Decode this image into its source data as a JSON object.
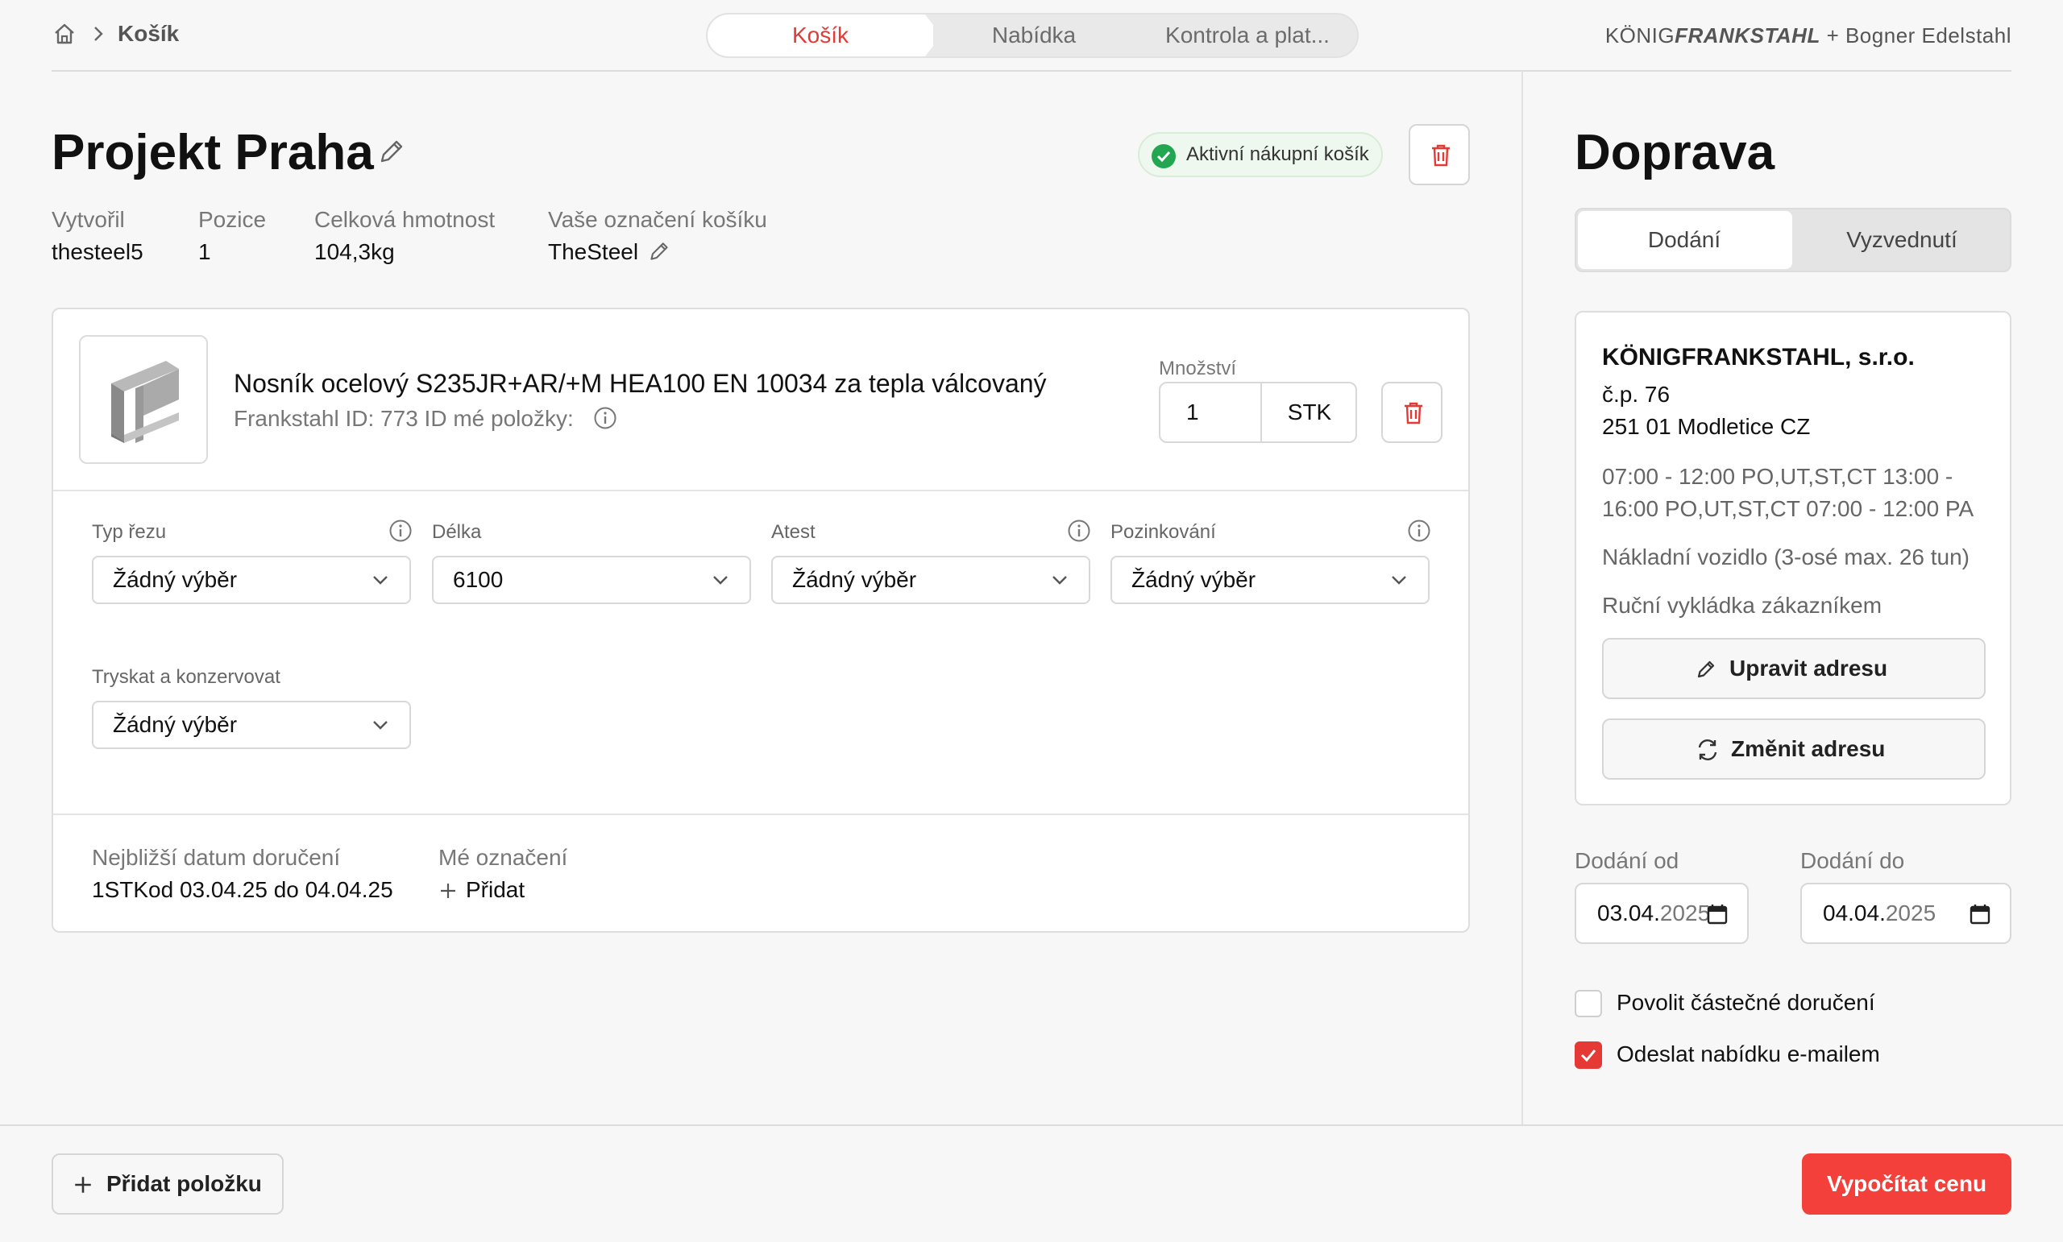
{
  "header": {
    "breadcrumb_label": "Košík",
    "steps": [
      "Košík",
      "Nabídka",
      "Kontrola a plat..."
    ],
    "brand_left": "KÖNIG",
    "brand_mid": "FRANKSTAHL",
    "brand_right": "+ Bogner Edelstahl"
  },
  "project": {
    "title": "Projekt Praha",
    "badge": "Aktivní nákupní košík",
    "meta": [
      {
        "label": "Vytvořil",
        "value": "thesteel5"
      },
      {
        "label": "Pozice",
        "value": "1"
      },
      {
        "label": "Celková hmotnost",
        "value": "104,3kg"
      },
      {
        "label": "Vaše označení košíku",
        "value": "TheSteel"
      }
    ]
  },
  "item": {
    "name": "Nosník ocelový S235JR+AR/+M HEA100 EN 10034 za tepla válcovaný",
    "sub": "Frankstahl ID: 773   ID mé položky:",
    "qty_label": "Množství",
    "qty_value": "1",
    "qty_unit": "STK",
    "fields": [
      {
        "label": "Typ řezu",
        "value": "Žádný výběr"
      },
      {
        "label": "Délka",
        "value": "6100"
      },
      {
        "label": "Atest",
        "value": "Žádný výběr"
      },
      {
        "label": "Pozinkování",
        "value": "Žádný výběr"
      },
      {
        "label": "Tryskat a konzervovat",
        "value": "Žádný výběr"
      }
    ],
    "delivery_label": "Nejbližší datum doručení",
    "delivery_value": "1STKod 03.04.25 do 04.04.25",
    "my_label_label": "Mé označení",
    "my_label_action": "Přidat"
  },
  "transport": {
    "title": "Doprava",
    "tabs": [
      "Dodání",
      "Vyzvednutí"
    ],
    "company": "KÖNIGFRANKSTAHL, s.r.o.",
    "street": "č.p. 76",
    "city": "251 01 Modletice CZ",
    "hours": "07:00 - 12:00 PO,UT,ST,CT 13:00 - 16:00 PO,UT,ST,CT 07:00 - 12:00 PA",
    "vehicle": "Nákladní vozidlo (3-osé max. 26 tun)",
    "unloading": "Ruční vykládka zákazníkem",
    "edit_address": "Upravit adresu",
    "change_address": "Změnit adresu",
    "date_from_label": "Dodání od",
    "date_from_day": "03.04.",
    "date_from_year": "2025",
    "date_to_label": "Dodání do",
    "date_to_day": "04.04.",
    "date_to_year": "2025",
    "partial_label": "Povolit částečné doručení",
    "partial_checked": false,
    "email_label": "Odeslat nabídku e-mailem",
    "email_checked": true
  },
  "footer": {
    "add_item": "Přidat položku",
    "calculate": "Vypočítat cenu"
  },
  "colors": {
    "accent": "#e53935",
    "success": "#22a652"
  }
}
